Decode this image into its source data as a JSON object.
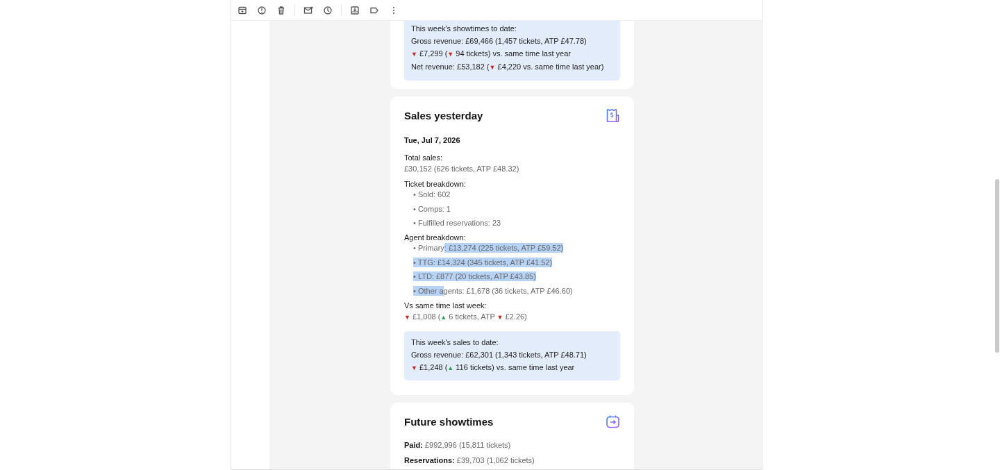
{
  "showtimes_summary": {
    "title": "This week's showtimes to date:",
    "lines": [
      [
        {
          "text": "Gross revenue: £69,466 (1,457 tickets, ATP £47.78)"
        }
      ],
      [
        {
          "text": "▼",
          "kind": "down"
        },
        {
          "text": " £7,299 ("
        },
        {
          "text": "▼",
          "kind": "down"
        },
        {
          "text": " 94 tickets) vs. same time last year"
        }
      ],
      [
        {
          "text": "Net revenue: £53,182 ("
        },
        {
          "text": "▼",
          "kind": "down"
        },
        {
          "text": " £4,220 vs. same time last year)"
        }
      ]
    ]
  },
  "sales_yesterday": {
    "title": "Sales yesterday",
    "date": "Tue, Jul 7, 2026",
    "total": {
      "label": "Total sales:",
      "value": "£30,152 (626 tickets, ATP £48.32)"
    },
    "ticket_breakdown": {
      "label": "Ticket breakdown:",
      "items": [
        "• Sold: 602",
        "• Comps: 1",
        "• Fulfilled reservations: 23"
      ]
    },
    "agent_breakdown": {
      "label": "Agent breakdown:",
      "items": [
        [
          {
            "text": "• Primary",
            "selected": false
          },
          {
            "text": ": £13,274 (225 tickets, ATP £59.52)",
            "selected": true
          }
        ],
        [
          {
            "text": "• TTG: £14,324 (345 tickets, ATP £41.52)",
            "selected": true
          }
        ],
        [
          {
            "text": "• LTD: £877 (20 tickets, ATP £43.85)",
            "selected": true
          }
        ],
        [
          {
            "text": "• Other a",
            "selected": true
          },
          {
            "text": "gents: £1,678 (36 tickets, ATP £46.60)",
            "selected": false
          }
        ]
      ]
    },
    "vs_last_week": {
      "label": "Vs same time last week:",
      "line": [
        {
          "text": "▼",
          "kind": "down"
        },
        {
          "text": " £1,008 ("
        },
        {
          "text": "▲",
          "kind": "up"
        },
        {
          "text": " 6 tickets, ATP "
        },
        {
          "text": "▼",
          "kind": "down"
        },
        {
          "text": " £2.26)"
        }
      ]
    },
    "summary": {
      "title": "This week's sales to date:",
      "lines": [
        [
          {
            "text": "Gross revenue: £62,301 (1,343 tickets, ATP £48.71)"
          }
        ],
        [
          {
            "text": "▼",
            "kind": "down"
          },
          {
            "text": " £1,248 ("
          },
          {
            "text": "▲",
            "kind": "up"
          },
          {
            "text": " 116 tickets) vs. same time last year"
          }
        ]
      ]
    }
  },
  "future_showtimes": {
    "title": "Future showtimes",
    "rows": [
      "**Paid:** £992,996 (15,811 tickets)",
      "**Reservations:** £39,703 (1,062 tickets)"
    ]
  }
}
